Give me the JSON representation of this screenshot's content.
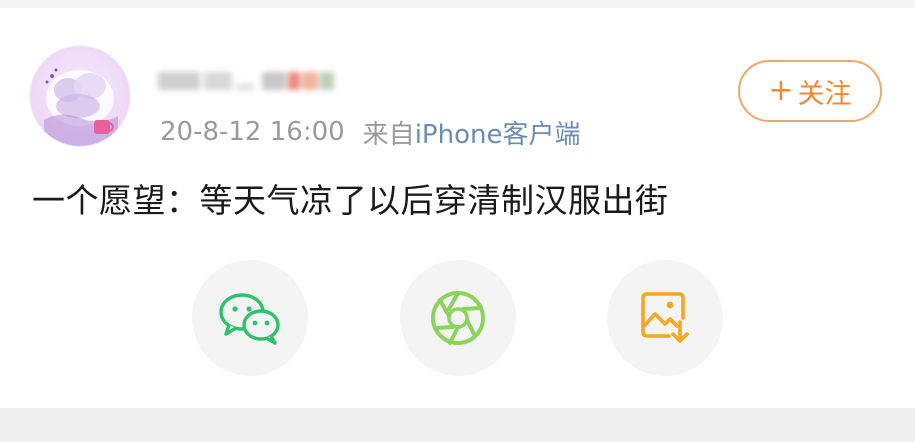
{
  "post": {
    "username": "",
    "timestamp": "20-8-12 16:00",
    "source_prefix": "来自",
    "source_client": "iPhone客户端",
    "content": "一个愿望：等天气凉了以后穿清制汉服出街"
  },
  "follow_button": {
    "plus": "+",
    "label": "关注"
  },
  "share_actions": [
    {
      "icon": "wechat-icon"
    },
    {
      "icon": "moments-icon"
    },
    {
      "icon": "save-image-icon"
    }
  ],
  "colors": {
    "accent_orange": "#ee8a36",
    "source_blue": "#6b8db4",
    "meta_gray": "#9a9a9a",
    "wechat_green": "#2dc26b",
    "moments_green": "#8bd35a",
    "save_orange": "#f5a623"
  }
}
